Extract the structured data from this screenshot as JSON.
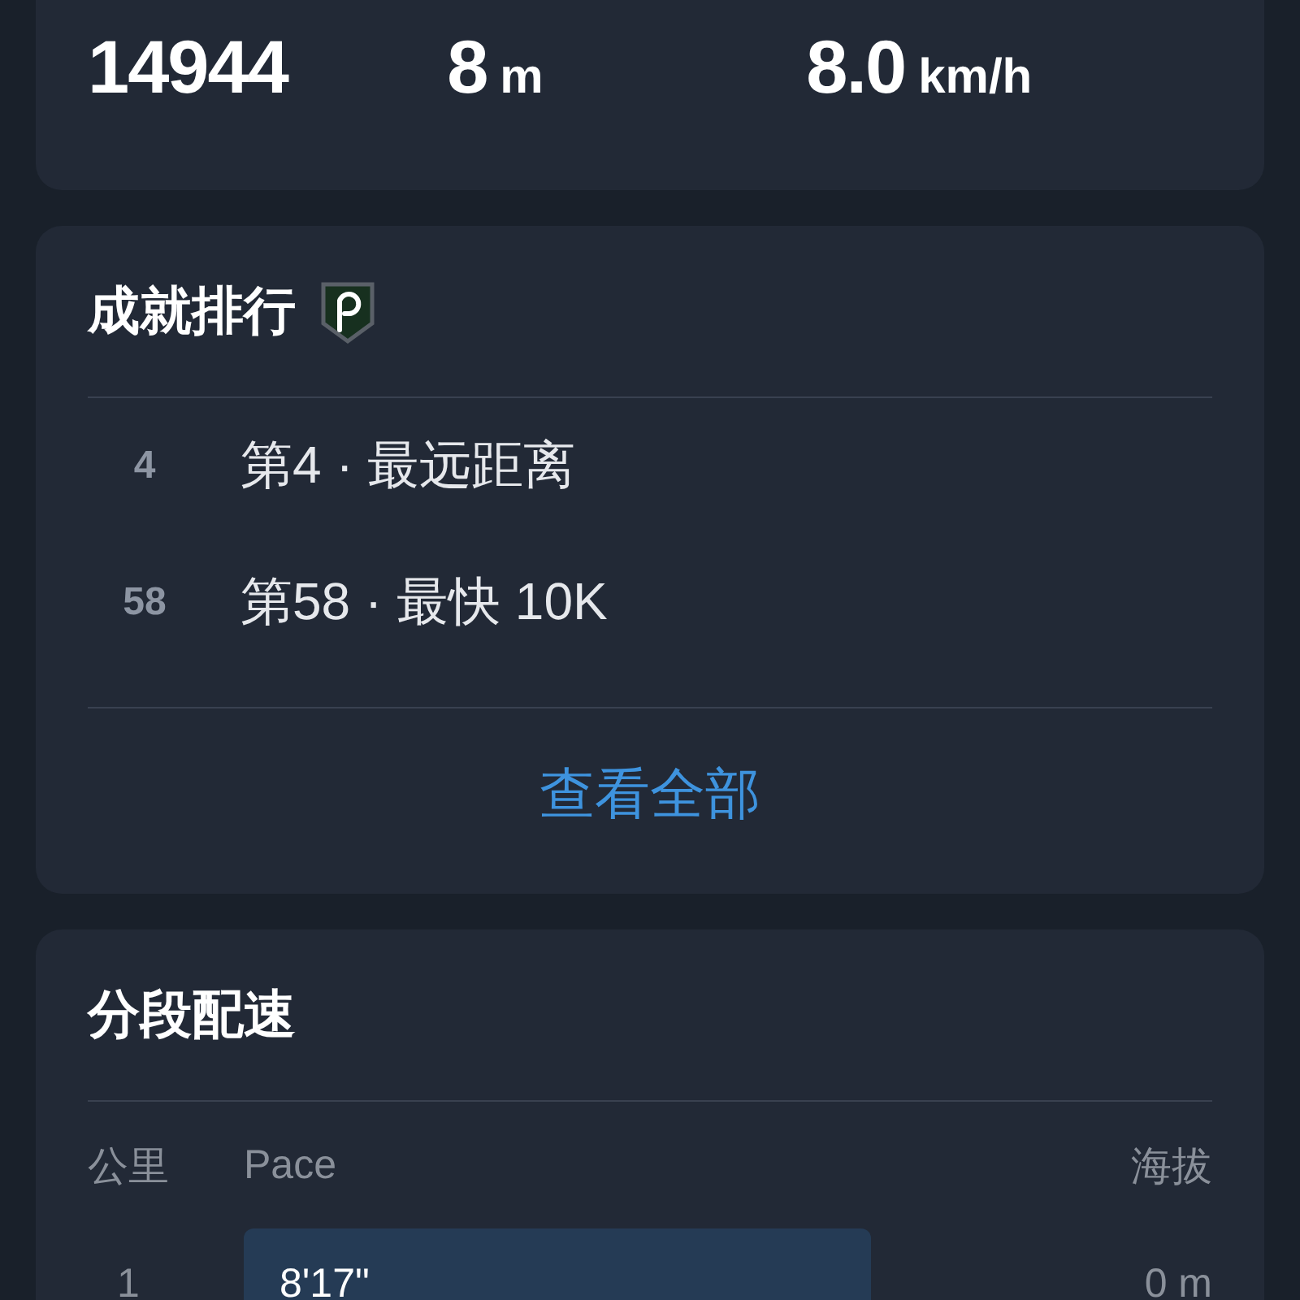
{
  "summary_stats": [
    {
      "value": "14944"
    },
    {
      "value": "8",
      "unit": "m"
    },
    {
      "value": "8.0",
      "unit": "km/h"
    }
  ],
  "achievements": {
    "title": "成就排行",
    "items": [
      {
        "rank": "4",
        "text": "第4 · 最远距离"
      },
      {
        "rank": "58",
        "text": "第58 · 最快 10K"
      }
    ],
    "link": "查看全部"
  },
  "splits": {
    "title": "分段配速",
    "columns": [
      "公里",
      "Pace",
      "海拔"
    ],
    "rows": [
      {
        "km": "1",
        "pace": "8'17\"",
        "elevation": "0 m"
      }
    ]
  }
}
